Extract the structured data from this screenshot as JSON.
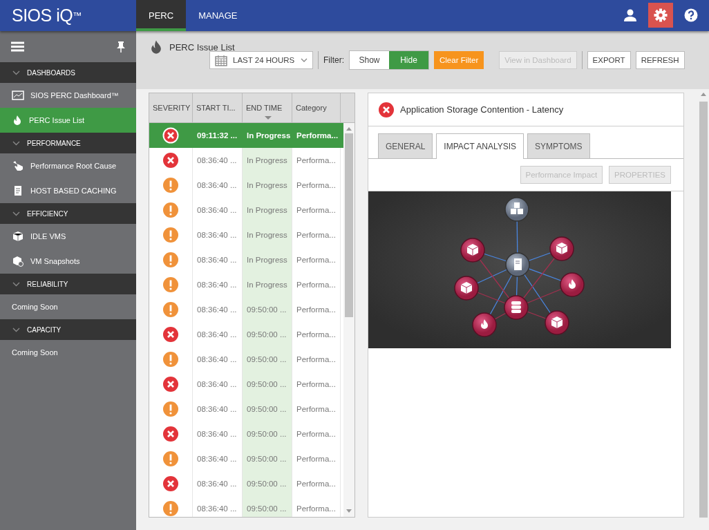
{
  "brand": {
    "name": "SIOS iQ",
    "mark": "™"
  },
  "top_tabs": [
    {
      "label": "PERC",
      "selected": true
    },
    {
      "label": "MANAGE",
      "selected": false
    }
  ],
  "top_icons": [
    {
      "kind": "user",
      "selected": false
    },
    {
      "kind": "settings",
      "selected": true
    },
    {
      "kind": "help",
      "selected": false
    }
  ],
  "sidebar": {
    "items": [
      {
        "kind": "section",
        "label": "DASHBOARDS",
        "expanded": true
      },
      {
        "kind": "link",
        "label": "SIOS PERC Dashboard™",
        "selected": false
      },
      {
        "kind": "link",
        "label": "PERC Issue List",
        "selected": true
      },
      {
        "kind": "section",
        "label": "PERFORMANCE",
        "expanded": true
      },
      {
        "kind": "link",
        "label": "Performance Root Cause",
        "selected": false
      },
      {
        "kind": "link",
        "label": "HOST BASED CACHING",
        "selected": false
      },
      {
        "kind": "section",
        "label": "EFFICIENCY",
        "expanded": true
      },
      {
        "kind": "link",
        "label": "IDLE VMS",
        "selected": false
      },
      {
        "kind": "link",
        "label": "VM Snapshots",
        "selected": false
      },
      {
        "kind": "section",
        "label": "RELIABILITY",
        "expanded": true
      },
      {
        "kind": "note",
        "label": "Coming Soon"
      },
      {
        "kind": "section",
        "label": "CAPACITY",
        "expanded": true
      },
      {
        "kind": "note",
        "label": "Coming Soon"
      }
    ]
  },
  "page_title": "PERC Issue List",
  "toolbar": {
    "range": "LAST 24 HOURS",
    "filter_label": "Filter:",
    "filter_options": [
      {
        "label": "Show",
        "selected": false
      },
      {
        "label": "Hide",
        "selected": true
      }
    ],
    "buttons": [
      {
        "label": "Clear Filter",
        "kind": "accent",
        "disabled": false
      },
      {
        "label": "View in Dashboard",
        "kind": "plain",
        "disabled": true
      },
      {
        "label": "EXPORT",
        "kind": "plain",
        "disabled": false
      },
      {
        "label": "REFRESH",
        "kind": "plain",
        "disabled": false
      }
    ]
  },
  "table": {
    "columns": [
      {
        "label": "SEVERITY",
        "sorted": false
      },
      {
        "label": "START TI...",
        "sorted": false
      },
      {
        "label": "END TIME",
        "sorted": true
      },
      {
        "label": "Category",
        "sorted": false
      }
    ],
    "rows": [
      {
        "kind": "error",
        "start": "09:11:32 ...",
        "end": "In Progress",
        "category": "Performa...",
        "selected": true
      },
      {
        "kind": "error",
        "start": "08:36:40 ...",
        "end": "In Progress",
        "category": "Performa...",
        "selected": false
      },
      {
        "kind": "warning",
        "start": "08:36:40 ...",
        "end": "In Progress",
        "category": "Performa...",
        "selected": false
      },
      {
        "kind": "warning",
        "start": "08:36:40 ...",
        "end": "In Progress",
        "category": "Performa...",
        "selected": false
      },
      {
        "kind": "warning",
        "start": "08:36:40 ...",
        "end": "In Progress",
        "category": "Performa...",
        "selected": false
      },
      {
        "kind": "warning",
        "start": "08:36:40 ...",
        "end": "In Progress",
        "category": "Performa...",
        "selected": false
      },
      {
        "kind": "warning",
        "start": "08:36:40 ...",
        "end": "In Progress",
        "category": "Performa...",
        "selected": false
      },
      {
        "kind": "warning",
        "start": "08:36:40 ...",
        "end": "09:50:00 ...",
        "category": "Performa...",
        "selected": false
      },
      {
        "kind": "error",
        "start": "08:36:40 ...",
        "end": "09:50:00 ...",
        "category": "Performa...",
        "selected": false
      },
      {
        "kind": "warning",
        "start": "08:36:40 ...",
        "end": "09:50:00 ...",
        "category": "Performa...",
        "selected": false
      },
      {
        "kind": "error",
        "start": "08:36:40 ...",
        "end": "09:50:00 ...",
        "category": "Performa...",
        "selected": false
      },
      {
        "kind": "warning",
        "start": "08:36:40 ...",
        "end": "09:50:00 ...",
        "category": "Performa...",
        "selected": false
      },
      {
        "kind": "error",
        "start": "08:36:40 ...",
        "end": "09:50:00 ...",
        "category": "Performa...",
        "selected": false
      },
      {
        "kind": "warning",
        "start": "08:36:40 ...",
        "end": "09:50:00 ...",
        "category": "Performa...",
        "selected": false
      },
      {
        "kind": "error",
        "start": "08:36:40 ...",
        "end": "09:50:00 ...",
        "category": "Performa...",
        "selected": false
      },
      {
        "kind": "warning",
        "start": "08:36:40 ...",
        "end": "09:50:00 ...",
        "category": "Performa...",
        "selected": false
      }
    ]
  },
  "detail": {
    "kind": "error",
    "title": "Application Storage Contention - Latency",
    "tabs": [
      {
        "label": "GENERAL",
        "selected": false
      },
      {
        "label": "IMPACT ANALYSIS",
        "selected": true
      },
      {
        "label": "SYMPTOMS",
        "selected": false
      }
    ],
    "buttons": [
      {
        "label": "Performance Impact",
        "disabled": true
      },
      {
        "label": "PROPERTIES",
        "disabled": true
      }
    ]
  }
}
